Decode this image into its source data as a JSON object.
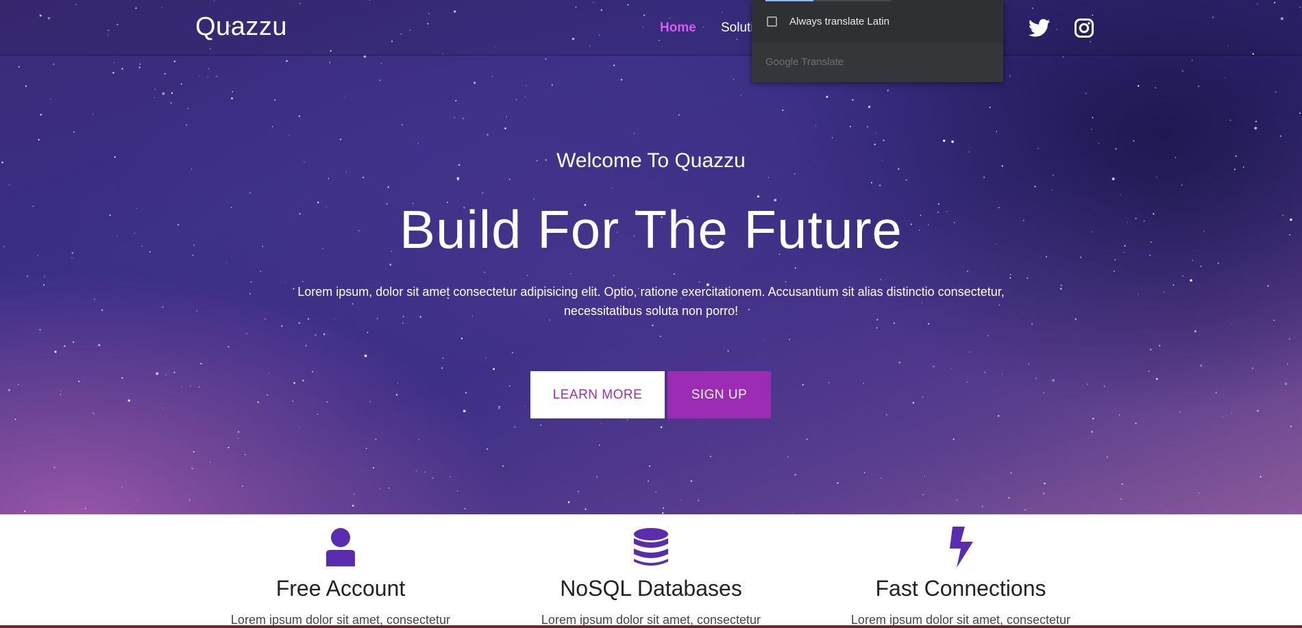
{
  "navbar": {
    "brand": "Quazzu",
    "links": [
      {
        "label": "Home",
        "active": true
      },
      {
        "label": "Soluti",
        "active": false
      }
    ],
    "social": [
      "twitter-icon",
      "instagram-icon"
    ]
  },
  "translate_popup": {
    "checkbox_label": "Always translate Latin",
    "checked": false,
    "brand": "Google Translate",
    "progress": 0.38
  },
  "hero": {
    "subtitle": "Welcome To Quazzu",
    "title": "Build For The Future",
    "text": "Lorem ipsum, dolor sit amet consectetur adipisicing elit. Optio, ratione exercitationem. Accusantium sit alias distinctio consectetur, necessitatibus soluta non porro!",
    "learn_more": "LEARN MORE",
    "sign_up": "SIGN UP"
  },
  "features": [
    {
      "icon": "user-icon",
      "title": "Free Account",
      "text": "Lorem ipsum dolor sit amet, consectetur"
    },
    {
      "icon": "database-icon",
      "title": "NoSQL Databases",
      "text": "Lorem ipsum dolor sit amet, consectetur"
    },
    {
      "icon": "lightning-bolt-icon",
      "title": "Fast Connections",
      "text": "Lorem ipsum dolor sit amet, consectetur"
    }
  ],
  "colors": {
    "accent": "#9c2cb3",
    "nav_active": "#d45cf0",
    "icon": "#5a2db0",
    "popup_bg": "#2e3034"
  }
}
